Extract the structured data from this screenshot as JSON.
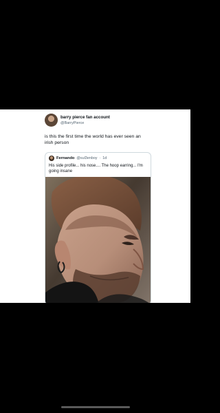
{
  "post": {
    "author": {
      "display_name": "barry pierce fan account",
      "handle": "@BarryPierce"
    },
    "text": "is this the first time the world has ever seen an irish person",
    "quoted_post": {
      "author_name": "Fernando",
      "author_handle": "@sul3enboy",
      "separator": "·",
      "time": "1d",
      "text": "His side profile... his nose.... The hoop earring... I'm going insane"
    }
  },
  "colors": {
    "screen_background": "#000000",
    "post_background": "#ffffff",
    "primary_text": "#0f1419",
    "secondary_text": "#536471",
    "border": "#cfd9de"
  },
  "icons": {
    "author_avatar": "avatar-icon",
    "quoted_avatar": "avatar-icon"
  }
}
